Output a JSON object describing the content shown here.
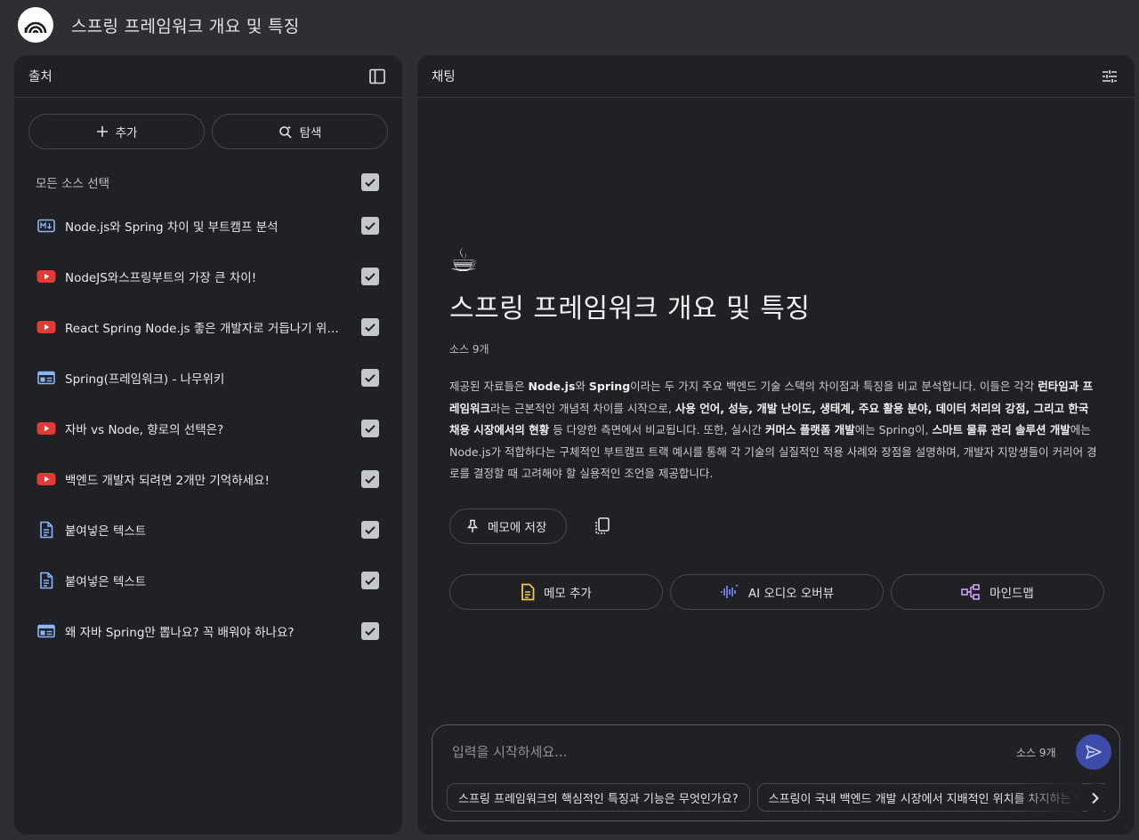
{
  "app": {
    "title": "스프링 프레임워크 개요 및 특징"
  },
  "sources_panel": {
    "title": "출처",
    "add_label": "추가",
    "search_label": "탐색",
    "select_all_label": "모든 소스 선택",
    "items": [
      {
        "label": "Node.js와 Spring 차이 및 부트캠프 분석",
        "icon": "markdown-icon",
        "checked": true
      },
      {
        "label": "NodeJS와스프링부트의 가장 큰 차이!",
        "icon": "youtube-icon",
        "checked": true
      },
      {
        "label": "React Spring Node.js 좋은 개발자로 거듭나기 위해 ...",
        "icon": "youtube-icon",
        "checked": true
      },
      {
        "label": "Spring(프레임워크) - 나무위키",
        "icon": "web-icon",
        "checked": true
      },
      {
        "label": "자바 vs Node, 향로의 선택은?",
        "icon": "youtube-icon",
        "checked": true
      },
      {
        "label": "백엔드 개발자 되려면 2개만 기억하세요!",
        "icon": "youtube-icon",
        "checked": true
      },
      {
        "label": "붙여넣은 텍스트",
        "icon": "document-icon",
        "checked": true
      },
      {
        "label": "붙여넣은 텍스트",
        "icon": "document-icon",
        "checked": true
      },
      {
        "label": "왜 자바 Spring만 뽑나요? 꼭 배워야 하나요?",
        "icon": "web-icon",
        "checked": true
      }
    ]
  },
  "chat_panel": {
    "title": "채팅",
    "emoji": "☕",
    "notebook_title": "스프링 프레임워크 개요 및 특징",
    "source_count": "소스 9개",
    "summary": {
      "p1": "제공된 자료들은 ",
      "b1": "Node.js",
      "p2": "와 ",
      "b2": "Spring",
      "p3": "이라는 두 가지 주요 백엔드 기술 스택의 차이점과 특징을 비교 분석합니다. 이들은 각각 ",
      "b3": "런타임과 프레임워크",
      "p4": "라는 근본적인 개념적 차이를 시작으로, ",
      "b4": "사용 언어, 성능, 개발 난이도, 생태계, 주요 활용 분야, 데이터 처리의 강점, 그리고 한국 채용 시장에서의 현황",
      "p5": " 등 다양한 측면에서 비교됩니다. 또한, 실시간 ",
      "b5": "커머스 플랫폼 개발",
      "p6": "에는 Spring이, ",
      "b6": "스마트 물류 관리 솔루션 개발",
      "p7": "에는 Node.js가 적합하다는 구체적인 부트캠프 트랙 예시를 통해 각 기술의 실질적인 적용 사례와 장점을 설명하며, 개발자 지망생들이 커리어 경로를 결정할 때 고려해야 할 실용적인 조언을 제공합니다."
    },
    "save_note_label": "메모에 저장",
    "tools": {
      "add_note": "메모 추가",
      "audio_overview": "AI 오디오 오버뷰",
      "mind_map": "마인드맵"
    },
    "composer": {
      "placeholder": "입력을 시작하세요...",
      "source_count": "소스 9개"
    },
    "suggestions": [
      "스프링 프레임워크의 핵심적인 특징과 기능은 무엇인가요?",
      "스프링이 국내 백엔드 개발 시장에서 지배적인 위치를 차지하는 이유는?"
    ]
  },
  "colors": {
    "background": "#2d2f33",
    "panel": "#1f2125",
    "youtube": "#e53935",
    "source_blue": "#8ab4f8",
    "send_button": "#3d4ca8"
  }
}
